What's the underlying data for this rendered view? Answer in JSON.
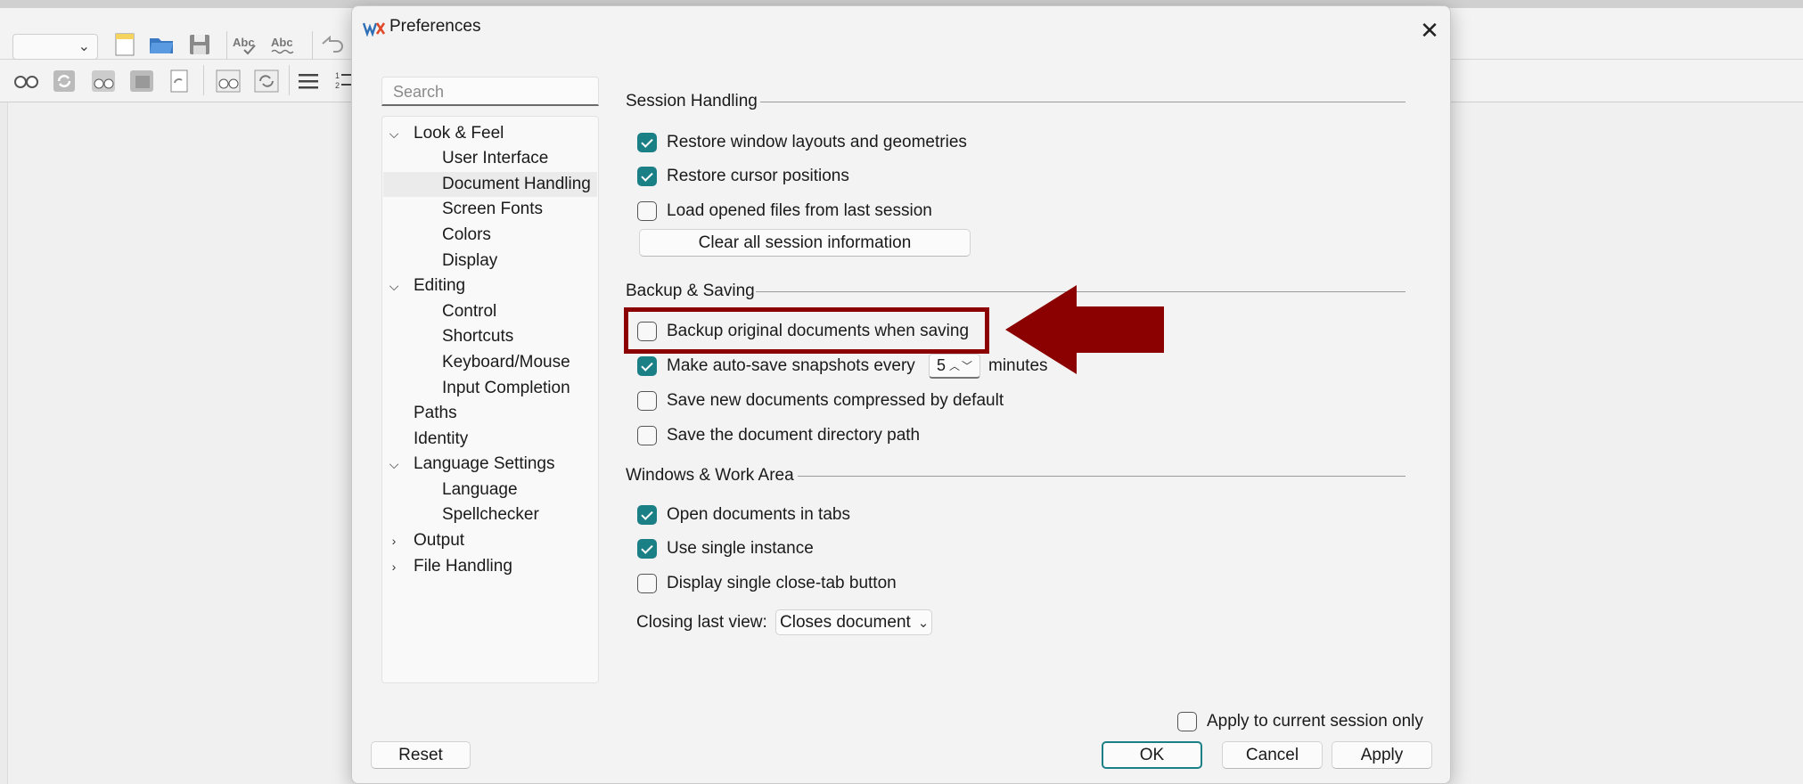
{
  "dialog": {
    "title": "Preferences",
    "close_symbol": "✕"
  },
  "sidebar": {
    "search_placeholder": "Search",
    "items": [
      {
        "label": "Look & Feel",
        "level": 0,
        "expander": "expanded"
      },
      {
        "label": "User Interface",
        "level": 1
      },
      {
        "label": "Document Handling",
        "level": 1,
        "selected": true
      },
      {
        "label": "Screen Fonts",
        "level": 1
      },
      {
        "label": "Colors",
        "level": 1
      },
      {
        "label": "Display",
        "level": 1
      },
      {
        "label": "Editing",
        "level": 0,
        "expander": "expanded"
      },
      {
        "label": "Control",
        "level": 1
      },
      {
        "label": "Shortcuts",
        "level": 1
      },
      {
        "label": "Keyboard/Mouse",
        "level": 1
      },
      {
        "label": "Input Completion",
        "level": 1
      },
      {
        "label": "Paths",
        "level": 0
      },
      {
        "label": "Identity",
        "level": 0
      },
      {
        "label": "Language Settings",
        "level": 0,
        "expander": "expanded"
      },
      {
        "label": "Language",
        "level": 1
      },
      {
        "label": "Spellchecker",
        "level": 1
      },
      {
        "label": "Output",
        "level": 0,
        "expander": "collapsed"
      },
      {
        "label": "File Handling",
        "level": 0,
        "expander": "collapsed"
      }
    ]
  },
  "session": {
    "heading": "Session Handling",
    "options": [
      {
        "label": "Restore window layouts and geometries",
        "checked": true
      },
      {
        "label": "Restore cursor positions",
        "checked": true
      },
      {
        "label": "Load opened files from last session",
        "checked": false
      }
    ],
    "clear_button": "Clear all session information"
  },
  "backup": {
    "heading": "Backup & Saving",
    "backup_original": {
      "label": "Backup original documents when saving",
      "checked": false
    },
    "autosave": {
      "label": "Make auto-save snapshots every",
      "checked": true,
      "value": "5",
      "unit": "minutes"
    },
    "compressed": {
      "label": "Save new documents compressed by default",
      "checked": false
    },
    "dir_path": {
      "label": "Save the document directory path",
      "checked": false
    }
  },
  "windows": {
    "heading": "Windows & Work Area",
    "options": [
      {
        "label": "Open documents in tabs",
        "checked": true
      },
      {
        "label": "Use single instance",
        "checked": true
      },
      {
        "label": "Display single close-tab button",
        "checked": false
      }
    ],
    "closing_label": "Closing last view:",
    "closing_value": "Closes document"
  },
  "footer": {
    "apply_current": {
      "label": "Apply to current session only",
      "checked": false
    },
    "reset": "Reset",
    "ok": "OK",
    "cancel": "Cancel",
    "apply": "Apply"
  },
  "colors": {
    "accent": "#1b7f86",
    "annotation": "#8b0000"
  }
}
